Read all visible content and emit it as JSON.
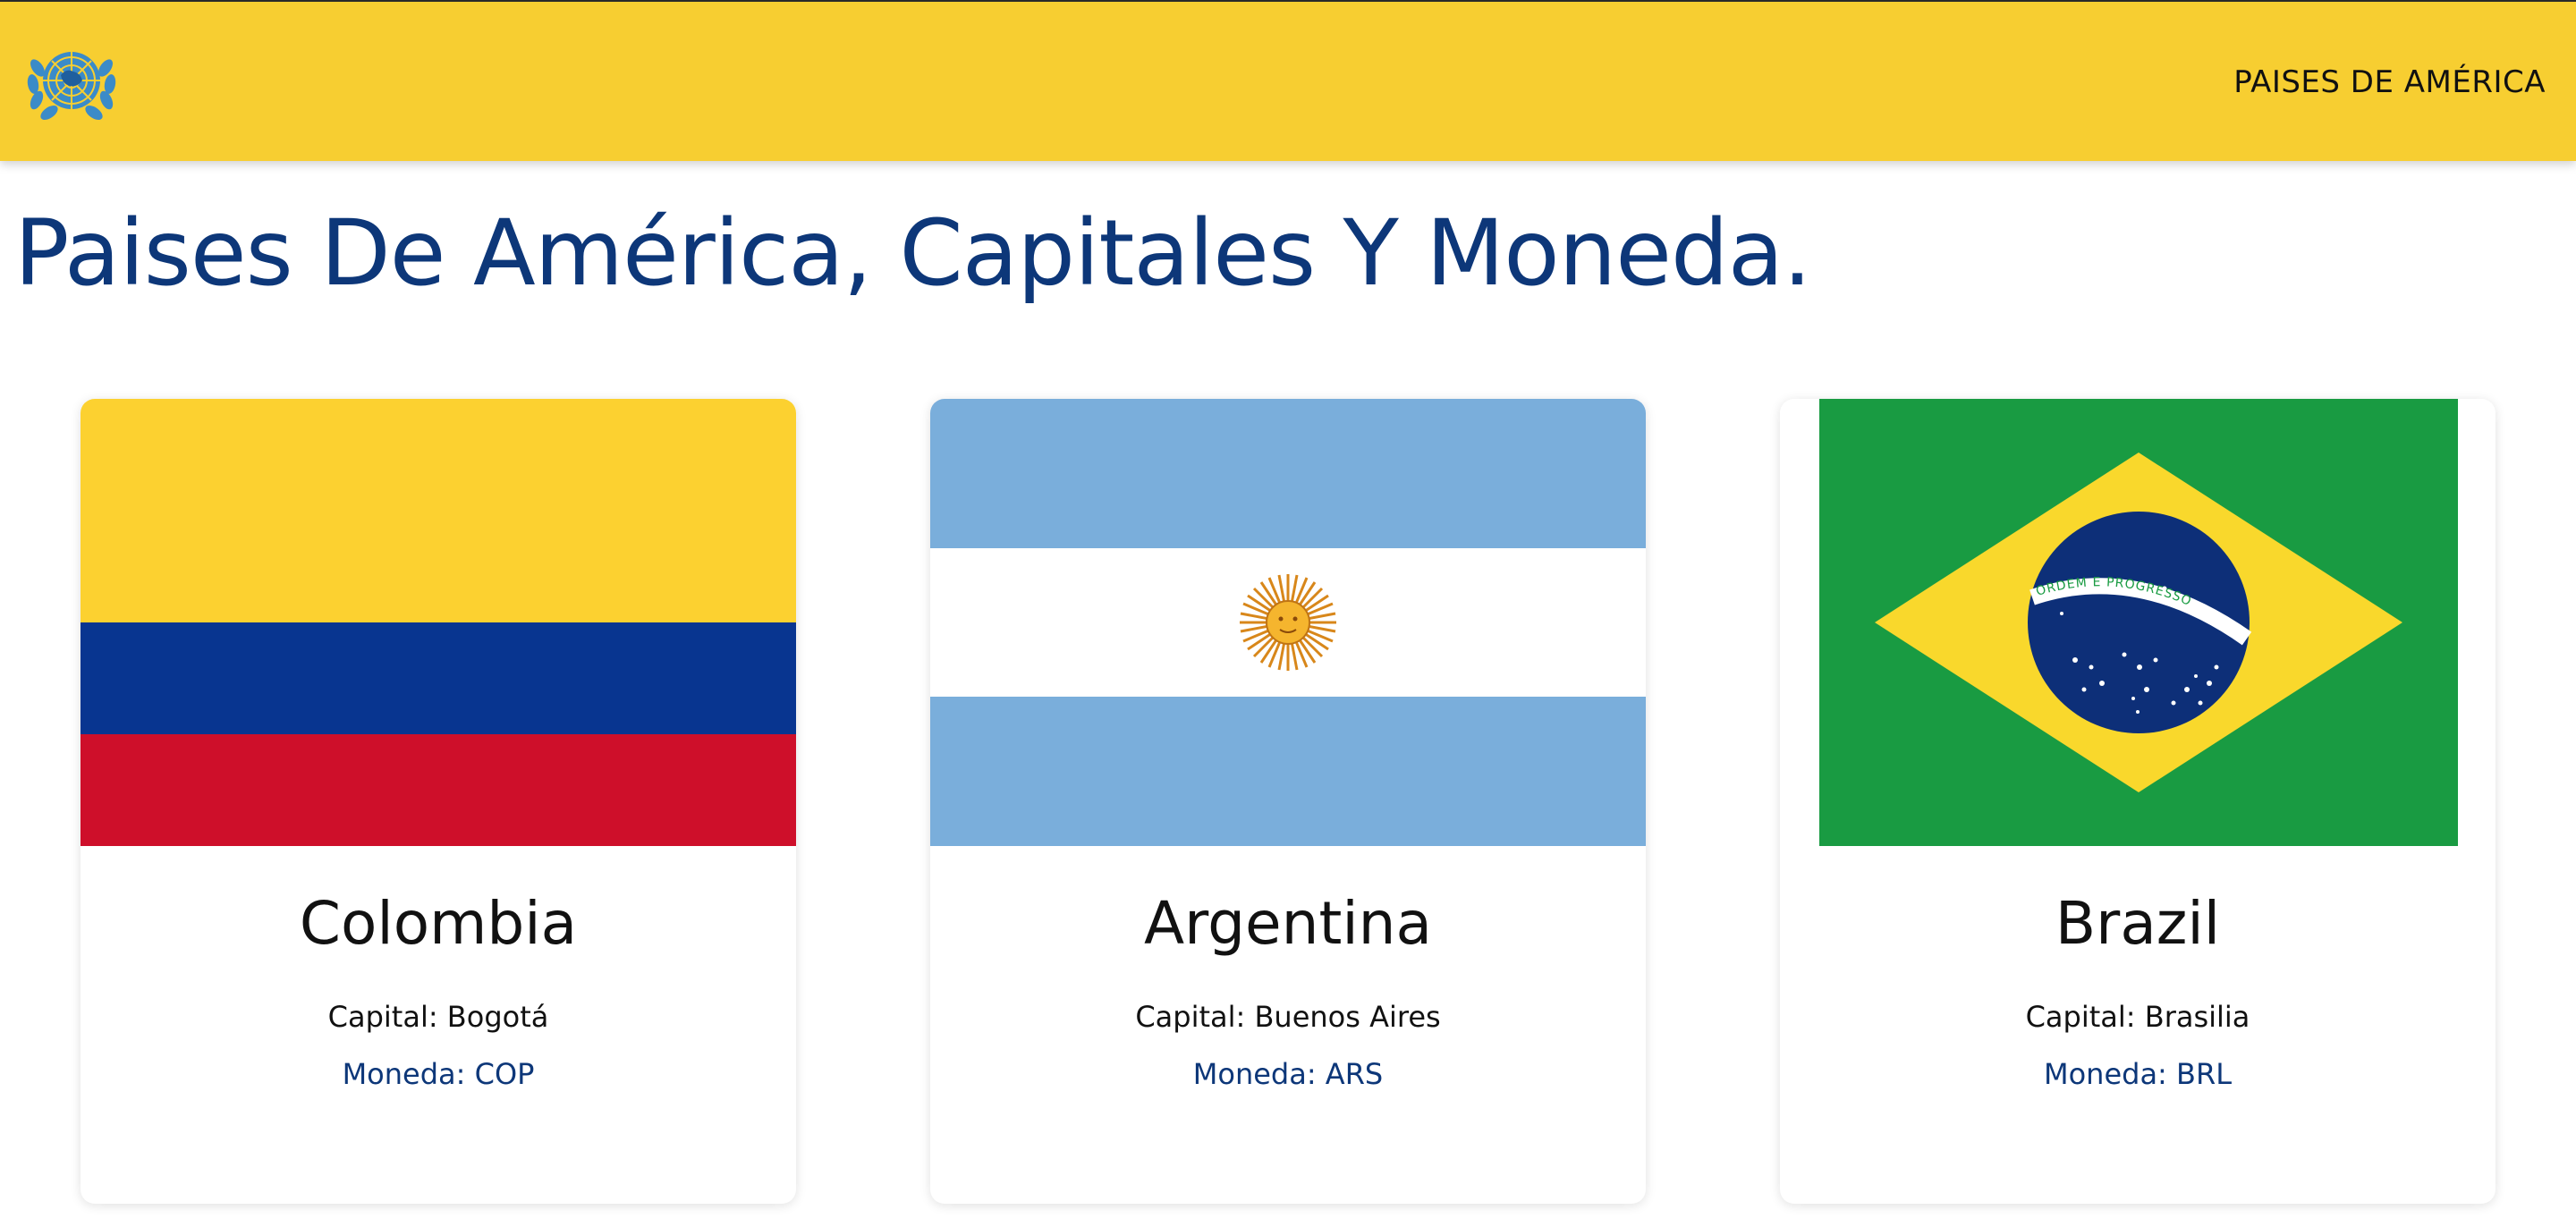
{
  "navbar": {
    "logo_icon": "un-emblem-icon",
    "link_label": "PAISES DE AMÉRICA",
    "background": "#f7ce31"
  },
  "page": {
    "title": "Paises De América, Capitales Y Moneda."
  },
  "countries": [
    {
      "name": "Colombia",
      "capital": "Capital: Bogotá",
      "currency": "Moneda: COP",
      "flag_icon": "colombia-flag",
      "flag_colors": [
        "#fcd130",
        "#083590",
        "#ce0f2a"
      ]
    },
    {
      "name": "Argentina",
      "capital": "Capital: Buenos Aires",
      "currency": "Moneda: ARS",
      "flag_icon": "argentina-flag",
      "flag_colors": [
        "#7aaedb",
        "#ffffff",
        "#f0a91c"
      ]
    },
    {
      "name": "Brazil",
      "capital": "Capital: Brasilia",
      "currency": "Moneda: BRL",
      "flag_icon": "brazil-flag",
      "flag_colors": [
        "#199b42",
        "#f9d82c",
        "#0d2f78"
      ],
      "flag_motto": "ORDEM E PROGRESSO"
    }
  ],
  "colors": {
    "title": "#0d3779",
    "currency_text": "#0d3779"
  }
}
